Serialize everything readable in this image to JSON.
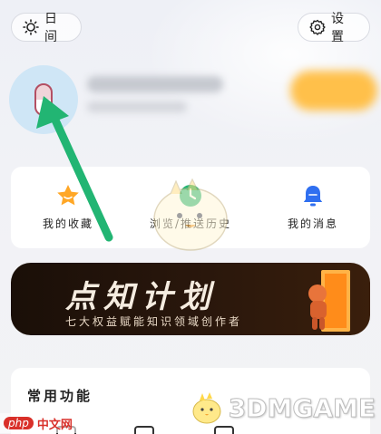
{
  "header": {
    "night_label": "日间",
    "settings_label": "设置"
  },
  "quick_actions": [
    {
      "label": "我的收藏",
      "icon": "star-icon"
    },
    {
      "label": "浏览/推送历史",
      "icon": "history-icon"
    },
    {
      "label": "我的消息",
      "icon": "bell-icon"
    }
  ],
  "banner": {
    "title": "点知计划",
    "subtitle": "七大权益赋能知识领域创作者"
  },
  "common_functions": {
    "title": "常用功能"
  },
  "watermarks": {
    "php_text": "中文网",
    "php_logo": "php",
    "game_site": "3DMGAME"
  },
  "colors": {
    "accent_green": "#22b573",
    "star_orange": "#ffa726",
    "bell_blue": "#2f6ff0",
    "banner_bg": "#1f120a"
  }
}
